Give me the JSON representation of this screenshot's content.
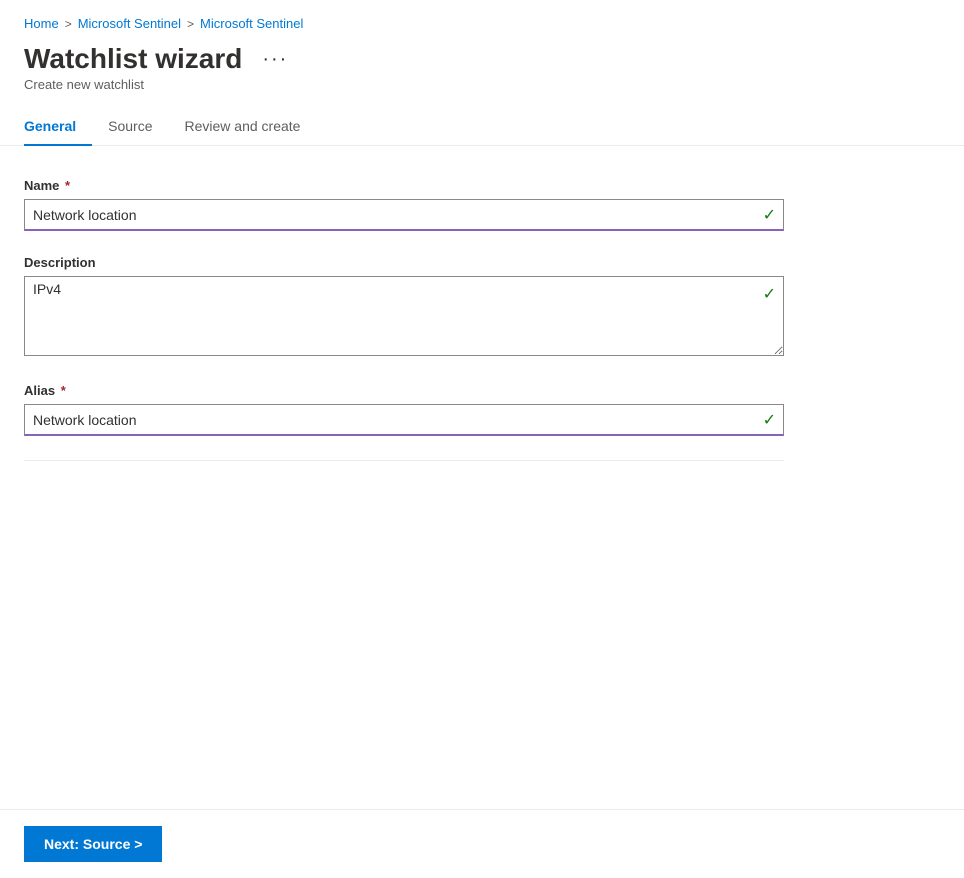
{
  "breadcrumb": {
    "items": [
      {
        "label": "Home",
        "href": "#"
      },
      {
        "label": "Microsoft Sentinel",
        "href": "#"
      },
      {
        "label": "Microsoft Sentinel",
        "href": "#"
      }
    ],
    "separator": ">"
  },
  "header": {
    "title": "Watchlist wizard",
    "subtitle": "Create new watchlist",
    "more_options_label": "···"
  },
  "tabs": [
    {
      "label": "General",
      "active": true
    },
    {
      "label": "Source",
      "active": false
    },
    {
      "label": "Review and create",
      "active": false
    }
  ],
  "form": {
    "name_label": "Name",
    "name_required": true,
    "name_value": "Network location",
    "description_label": "Description",
    "description_value": "IPv4",
    "alias_label": "Alias",
    "alias_required": true,
    "alias_value": "Network location"
  },
  "footer": {
    "next_button_label": "Next: Source >"
  }
}
